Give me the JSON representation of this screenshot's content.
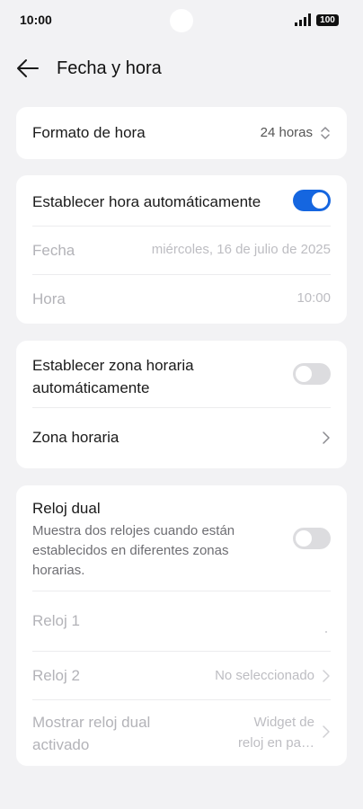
{
  "status": {
    "time": "10:00",
    "battery": "100"
  },
  "header": {
    "title": "Fecha y hora"
  },
  "format": {
    "label": "Formato de hora",
    "value": "24 horas"
  },
  "auto_time": {
    "label": "Establecer hora automáticamente",
    "enabled": true
  },
  "date": {
    "label": "Fecha",
    "value": "miércoles, 16 de julio de 2025"
  },
  "time": {
    "label": "Hora",
    "value": "10:00"
  },
  "auto_zone": {
    "label_line1": "Establecer zona horaria",
    "label_line2": "automáticamente",
    "enabled": false
  },
  "zone": {
    "label": "Zona horaria"
  },
  "dual": {
    "title": "Reloj dual",
    "desc_line1": "Muestra dos relojes cuando están",
    "desc_line2": "establecidos en diferentes zonas",
    "desc_line3": "horarias.",
    "enabled": false
  },
  "clock1": {
    "label": "Reloj 1"
  },
  "clock2": {
    "label": "Reloj 2",
    "value": "No seleccionado"
  },
  "show_dual": {
    "label_line1": "Mostrar reloj dual",
    "label_line2": "activado",
    "value_line1": "Widget de",
    "value_line2": "reloj en pa…"
  },
  "colors": {
    "accent": "#1566e0",
    "background": "#f2f2f4",
    "card": "#ffffff"
  }
}
